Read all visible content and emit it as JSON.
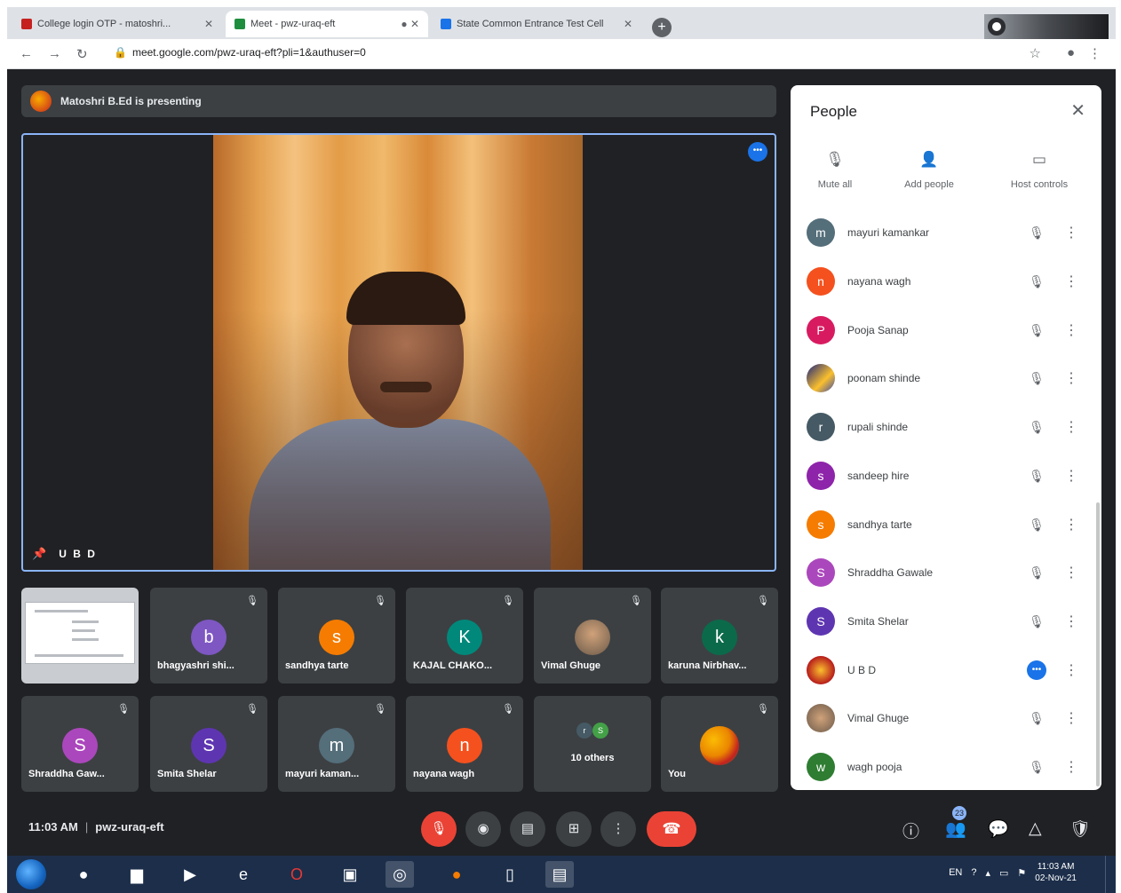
{
  "browser": {
    "tabs": [
      {
        "title": "College login OTP - matoshri... ",
        "color": "#c5221f",
        "active": false
      },
      {
        "title": "Meet - pwz-uraq-eft",
        "color": "#1e8e3e",
        "active": true
      },
      {
        "title": "State Common Entrance Test Cell",
        "color": "#1a73e8",
        "active": false
      }
    ],
    "new_tab": "+",
    "url": "meet.google.com/pwz-uraq-eft?pli=1&authuser=0"
  },
  "meet": {
    "presenting_banner": "Matoshri B.Ed is presenting",
    "main_speaker_label": "U B D",
    "more_glyph": "•••",
    "tiles_row1": [
      {
        "name": "",
        "type": "screen"
      },
      {
        "name": "bhagyashri shi...",
        "initial": "b",
        "color": "#7e57c2"
      },
      {
        "name": "sandhya tarte",
        "initial": "s",
        "color": "#f57c00"
      },
      {
        "name": "KAJAL CHAKO...",
        "initial": "K",
        "color": "#00897b"
      },
      {
        "name": "Vimal Ghuge",
        "type": "photo"
      },
      {
        "name": "karuna Nirbhav...",
        "initial": "k",
        "color": "#0b6a4a"
      }
    ],
    "tiles_row2": [
      {
        "name": "Shraddha Gaw...",
        "initial": "S",
        "color": "#ab47bc"
      },
      {
        "name": "Smita Shelar",
        "initial": "S",
        "color": "#5e35b1"
      },
      {
        "name": "mayuri kaman...",
        "initial": "m",
        "color": "#546e7a"
      },
      {
        "name": "nayana wagh",
        "initial": "n",
        "color": "#f4511e"
      },
      {
        "name": "10 others",
        "type": "others"
      },
      {
        "name": "You",
        "type": "you"
      }
    ],
    "others_avatars": [
      {
        "initial": "r",
        "color": "#455a64"
      },
      {
        "initial": "S",
        "color": "#43a047"
      }
    ],
    "time": "11:03 AM",
    "meeting_code": "pwz-uraq-eft",
    "participant_count": "23"
  },
  "people_panel": {
    "title": "People",
    "actions": [
      "Mute all",
      "Add people",
      "Host controls"
    ],
    "participants": [
      {
        "name": "mayuri kamankar",
        "initial": "m",
        "color": "#546e7a",
        "speaking": false
      },
      {
        "name": "nayana wagh",
        "initial": "n",
        "color": "#f4511e",
        "speaking": false
      },
      {
        "name": "Pooja Sanap",
        "initial": "P",
        "color": "#d81b60",
        "speaking": false
      },
      {
        "name": "poonam shinde",
        "initial": "",
        "color": "#3949ab",
        "speaking": false
      },
      {
        "name": "rupali shinde",
        "initial": "r",
        "color": "#455a64",
        "speaking": false
      },
      {
        "name": "sandeep hire",
        "initial": "s",
        "color": "#8e24aa",
        "speaking": false
      },
      {
        "name": "sandhya tarte",
        "initial": "s",
        "color": "#f57c00",
        "speaking": false
      },
      {
        "name": "Shraddha Gawale",
        "initial": "S",
        "color": "#ab47bc",
        "speaking": false
      },
      {
        "name": "Smita Shelar",
        "initial": "S",
        "color": "#5e35b1",
        "speaking": false
      },
      {
        "name": "U B D",
        "initial": "",
        "color": "#b71c1c",
        "speaking": true
      },
      {
        "name": "Vimal Ghuge",
        "initial": "",
        "color": "#8d6e63",
        "speaking": false
      },
      {
        "name": "wagh pooja",
        "initial": "w",
        "color": "#2e7d32",
        "speaking": false
      }
    ]
  },
  "taskbar": {
    "lang": "EN",
    "time": "11:03 AM",
    "date": "02-Nov-21"
  }
}
